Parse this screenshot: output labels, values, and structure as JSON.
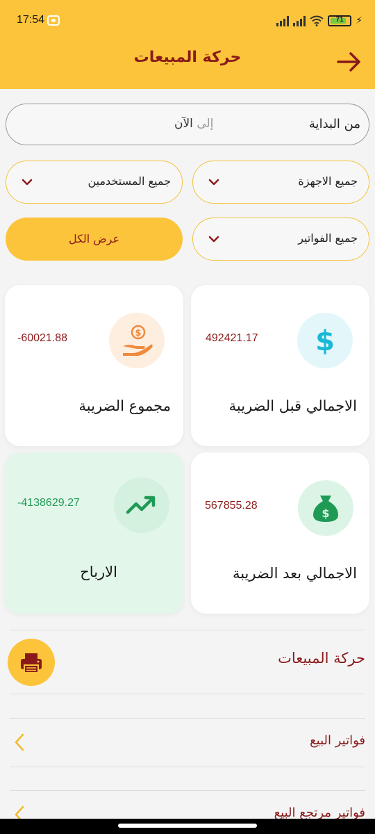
{
  "status_bar": {
    "time": "17:54",
    "battery": "71"
  },
  "header": {
    "title": "حركة المبيعات",
    "back_icon": "arrow-right-icon"
  },
  "date_range": {
    "from_label": "من البداية",
    "to_prefix": "إلى",
    "to_value": "الآن"
  },
  "filters": {
    "devices": "جميع الاجهزة",
    "users": "جميع المستخدمين",
    "invoices": "جميع الفواتير",
    "show_all": "عرض الكل"
  },
  "cards": {
    "before_tax": {
      "value": "492421.17",
      "label": "الاجمالي قبل الضريبة",
      "icon": "dollar-icon"
    },
    "tax_total": {
      "value": "-60021.88",
      "label": "مجموع الضريبة",
      "icon": "hand-coin-icon"
    },
    "after_tax": {
      "value": "567855.28",
      "label": "الاجمالي بعد الضريبة",
      "icon": "money-bag-icon"
    },
    "profits": {
      "value": "-4138629.27",
      "label": "الارباح",
      "icon": "trending-up-icon"
    }
  },
  "colors": {
    "accent": "#fcc43a",
    "brand_text": "#8a1a1a",
    "profit_green": "#1f9a55"
  },
  "section": {
    "title": "حركة المبيعات",
    "print_icon": "printer-icon"
  },
  "list": [
    {
      "label": "فواتير البيع"
    },
    {
      "label": "فواتير مرتجع البيع"
    }
  ]
}
